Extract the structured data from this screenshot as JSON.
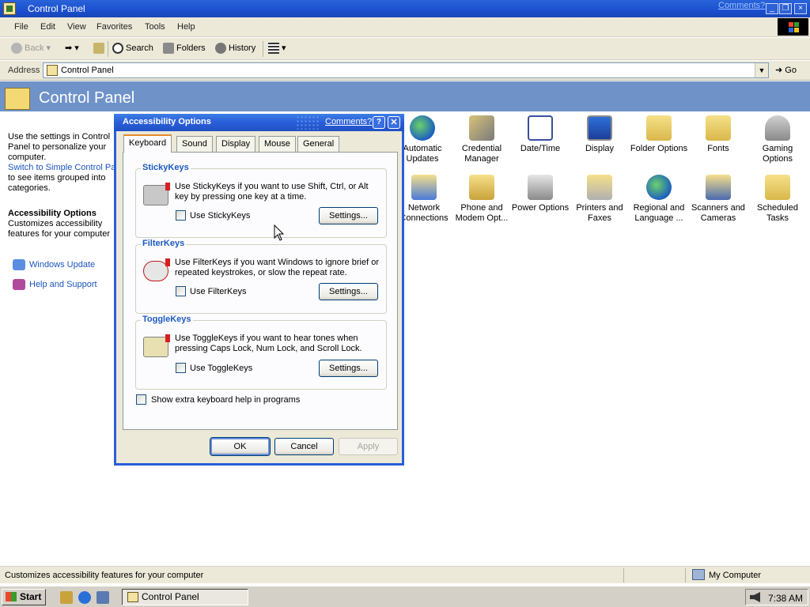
{
  "window": {
    "title": "Control Panel",
    "comments": "Comments?"
  },
  "menu": [
    "File",
    "Edit",
    "View",
    "Favorites",
    "Tools",
    "Help"
  ],
  "toolbar": {
    "back": "Back",
    "search": "Search",
    "folders": "Folders",
    "history": "History"
  },
  "address": {
    "label": "Address",
    "value": "Control Panel",
    "go": "Go"
  },
  "header": {
    "title": "Control Panel"
  },
  "leftpane": {
    "intro": "Use the settings in Control Panel to personalize your computer.",
    "switch_link": "Switch to Simple Control Panel",
    "switch_desc": "to see items grouped into categories.",
    "selected_title": "Accessibility Options",
    "selected_desc": "Customizes accessibility features for your computer",
    "see_also": [
      "Windows Update",
      "Help and Support"
    ]
  },
  "icons": [
    {
      "label": "Automatic Updates"
    },
    {
      "label": "Credential Manager"
    },
    {
      "label": "Date/Time"
    },
    {
      "label": "Display"
    },
    {
      "label": "Folder Options"
    },
    {
      "label": "Fonts"
    },
    {
      "label": "Gaming Options"
    },
    {
      "label": "Network Connections"
    },
    {
      "label": "Phone and Modem Opt..."
    },
    {
      "label": "Power Options"
    },
    {
      "label": "Printers and Faxes"
    },
    {
      "label": "Regional and Language ..."
    },
    {
      "label": "Scanners and Cameras"
    },
    {
      "label": "Scheduled Tasks"
    }
  ],
  "status": {
    "text": "Customizes accessibility features for your computer",
    "zone": "My Computer"
  },
  "taskbar": {
    "start": "Start",
    "task": "Control Panel",
    "clock": "7:38 AM"
  },
  "dialog": {
    "title": "Accessibility Options",
    "comments": "Comments?",
    "help": "?",
    "tabs": [
      "Keyboard",
      "Sound",
      "Display",
      "Mouse",
      "General"
    ],
    "active_tab": "Keyboard",
    "groups": [
      {
        "title": "StickyKeys",
        "desc": "Use StickyKeys if you want to use Shift, Ctrl, or Alt key by pressing one key at a time.",
        "checkbox": "Use StickyKeys",
        "checked": false,
        "button": "Settings..."
      },
      {
        "title": "FilterKeys",
        "desc": "Use FilterKeys if you want Windows to ignore brief or repeated keystrokes, or slow the repeat rate.",
        "checkbox": "Use FilterKeys",
        "checked": false,
        "button": "Settings..."
      },
      {
        "title": "ToggleKeys",
        "desc": "Use ToggleKeys if you want to hear tones when pressing Caps Lock, Num Lock, and Scroll Lock.",
        "checkbox": "Use ToggleKeys",
        "checked": false,
        "button": "Settings..."
      }
    ],
    "extra_help": "Show extra keyboard help in programs",
    "extra_help_checked": false,
    "buttons": {
      "ok": "OK",
      "cancel": "Cancel",
      "apply": "Apply"
    }
  },
  "colors": {
    "titlebar": "#1b4fcf",
    "header": "#6f93c9",
    "link": "#1b55c0",
    "group_title": "#1d5abf"
  }
}
